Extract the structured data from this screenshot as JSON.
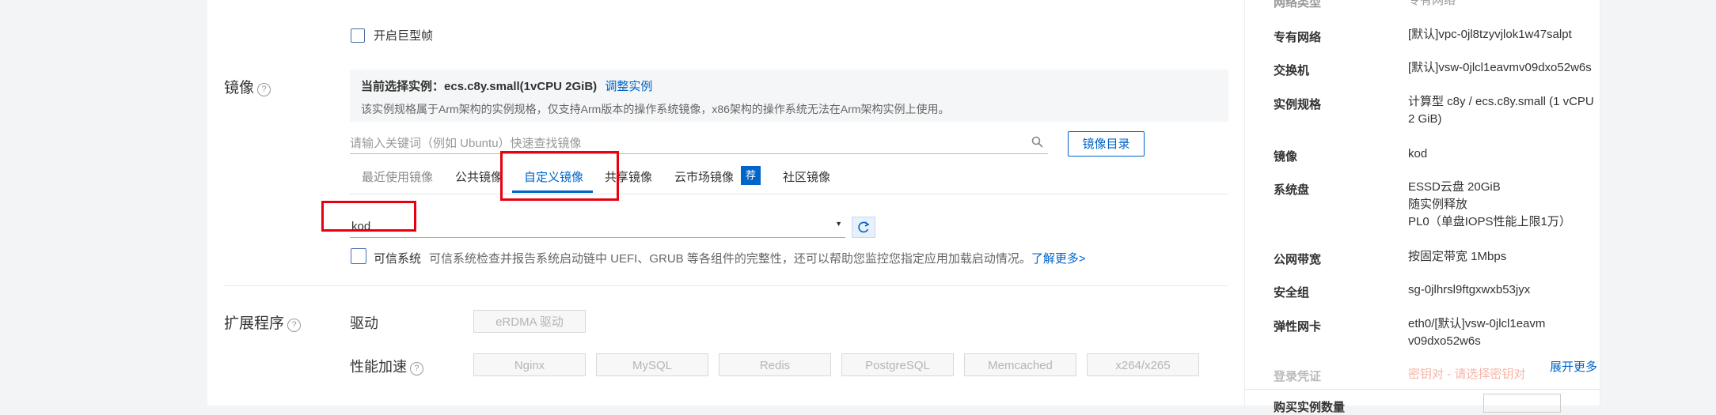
{
  "jumbo_frame_label": "开启巨型帧",
  "image_section": {
    "label": "镜像",
    "info_current_prefix": "当前选择实例：",
    "info_current_value": "ecs.c8y.small(1vCPU 2GiB)",
    "adjust_link": "调整实例",
    "info_desc": "该实例规格属于Arm架构的实例规格，仅支持Arm版本的操作系统镜像，x86架构的操作系统无法在Arm架构实例上使用。",
    "search_placeholder": "请输入关键词（例如 Ubuntu）快速查找镜像",
    "catalog_button": "镜像目录",
    "tabs": [
      "最近使用镜像",
      "公共镜像",
      "自定义镜像",
      "共享镜像",
      "云市场镜像",
      "社区镜像"
    ],
    "market_badge": "荐",
    "selected_image": "kod",
    "trusted_label": "可信系统",
    "trusted_desc": "可信系统检查并报告系统启动链中 UEFI、GRUB 等各组件的完整性，还可以帮助您监控您指定应用加载启动情况。",
    "learn_more": "了解更多>"
  },
  "extensions": {
    "label": "扩展程序",
    "driver_label": "驱动",
    "driver_button": "eRDMA 驱动",
    "accel_label": "性能加速",
    "accel_buttons": [
      "Nginx",
      "MySQL",
      "Redis",
      "PostgreSQL",
      "Memcached",
      "x264/x265"
    ]
  },
  "summary": {
    "rows": [
      {
        "label": "网络类型",
        "value": "专有网络"
      },
      {
        "label": "专有网络",
        "value": "[默认]vpc-0jl8tzyvjlok1w47salpt"
      },
      {
        "label": "交换机",
        "value": "[默认]vsw-0jlcl1eavmv09dxo52w6s"
      },
      {
        "label": "实例规格",
        "value": "计算型 c8y / ecs.c8y.small (1 vCPU 2 GiB)"
      },
      {
        "label": "镜像",
        "value": "kod"
      },
      {
        "label": "系统盘",
        "value": "ESSD云盘 20GiB"
      },
      {
        "label": "公网带宽",
        "value": "按固定带宽 1Mbps"
      },
      {
        "label": "安全组",
        "value": "sg-0jlhrsl9ftgxwxb53jyx"
      },
      {
        "label": "弹性网卡",
        "value": "eth0/[默认]vsw-0jlcl1eavmv09dxo52w6s"
      },
      {
        "label": "登录凭证",
        "value": "密钥对 - 请选择密钥对"
      }
    ],
    "disk_line2": "随实例释放",
    "disk_line3": "PL0（单盘IOPS性能上限1万）",
    "expand_more": "展开更多",
    "bottom_label": "购买实例数量"
  },
  "colors": {
    "accent": "#0064c8",
    "highlight": "#e8000f",
    "badge": "#0064c8"
  }
}
